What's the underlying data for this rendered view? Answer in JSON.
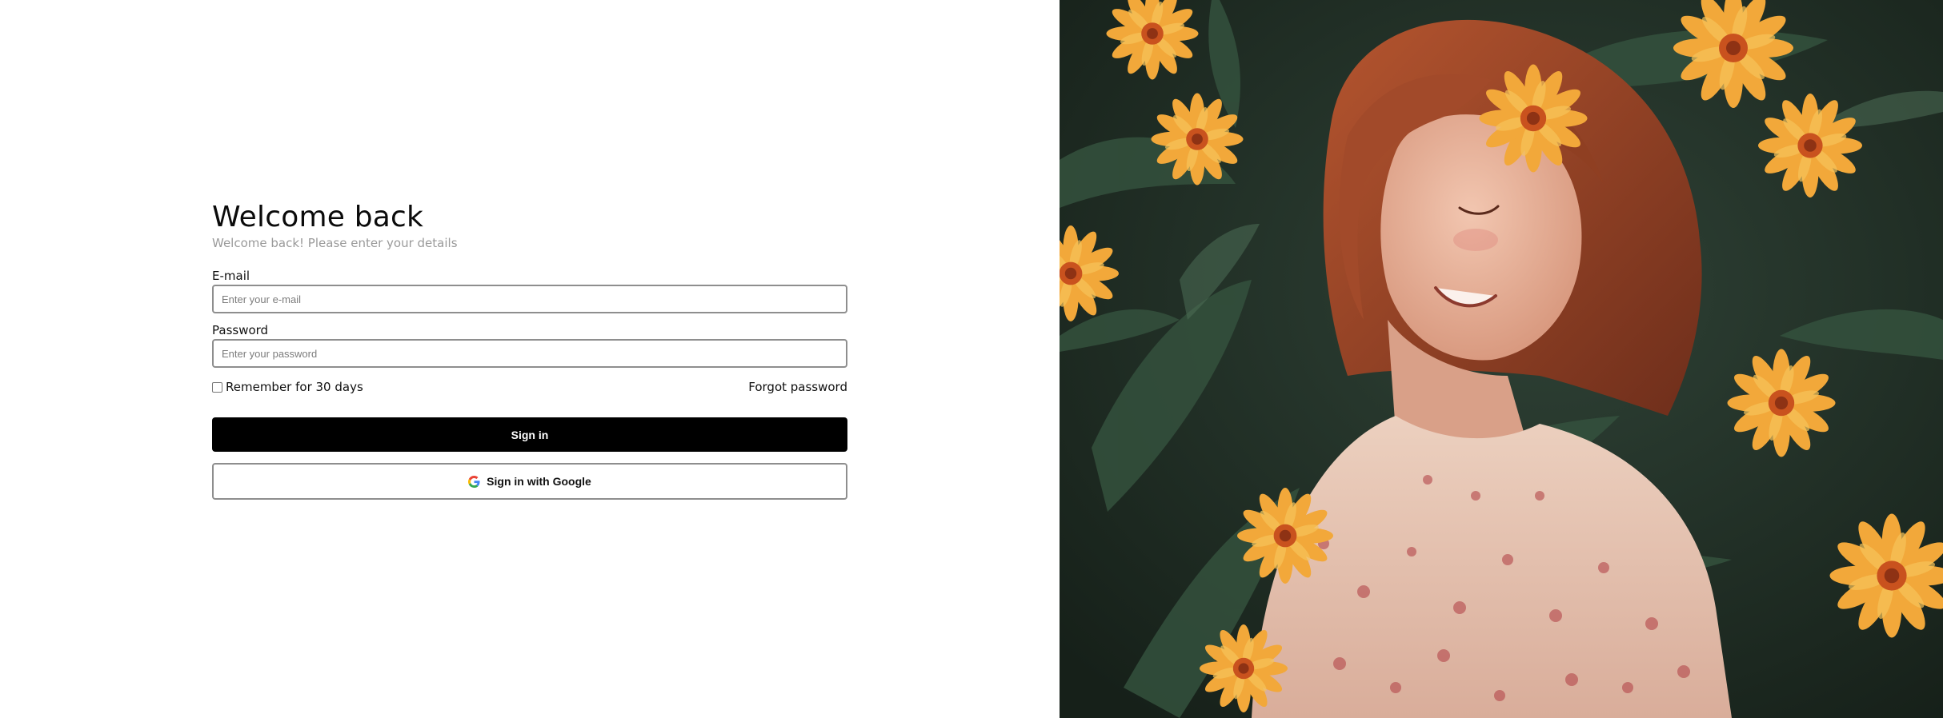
{
  "form": {
    "title": "Welcome back",
    "subtitle": "Welcome back! Please enter your details",
    "email": {
      "label": "E-mail",
      "placeholder": "Enter your e-mail",
      "value": ""
    },
    "password": {
      "label": "Password",
      "placeholder": "Enter your password",
      "value": ""
    },
    "remember_label": "Remember for 30 days",
    "remember_checked": false,
    "forgot_label": "Forgot password",
    "signin_label": "Sign in",
    "google_label": "Sign in with Google"
  },
  "hero_image": {
    "icon": "portrait-photo",
    "colors": {
      "background": "#1d2a23",
      "leaf": "#3d5a45",
      "flower": "#f0a43a",
      "flower_center": "#c9521e",
      "hair": "#a0472a",
      "skin": "#e8b49c",
      "blouse": "#e6c2b0"
    }
  },
  "colors": {
    "primary_button": "#000000",
    "input_border": "#8e8e8e",
    "subtitle_text": "#9a9a9a"
  }
}
